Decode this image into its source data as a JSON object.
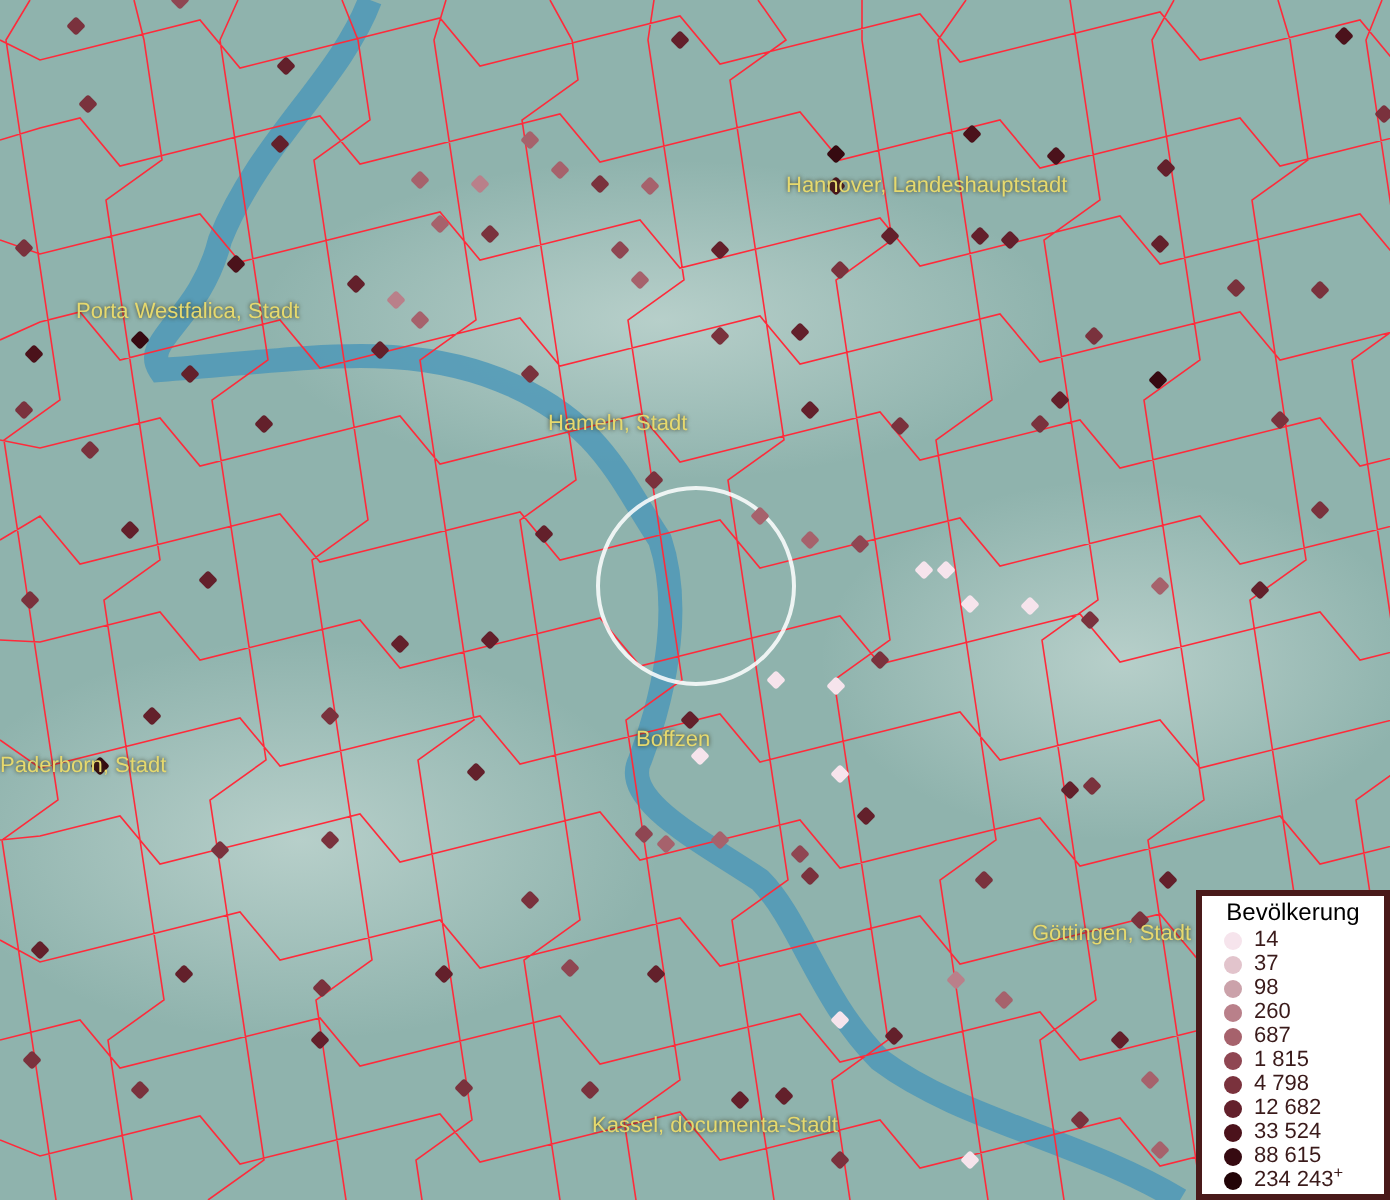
{
  "map": {
    "labels": [
      {
        "text": "Hannover, Landeshauptstadt"
      },
      {
        "text": "Porta Westfalica, Stadt"
      },
      {
        "text": "Hameln, Stadt"
      },
      {
        "text": "Boffzen"
      },
      {
        "text": "Paderborn, Stadt"
      },
      {
        "text": "Göttingen, Stadt"
      },
      {
        "text": "Kassel, documenta-Stadt"
      }
    ]
  },
  "legend": {
    "title": "Bevölkerung",
    "items": [
      {
        "label": "14",
        "color": "#f6e4ec"
      },
      {
        "label": "37",
        "color": "#e2c4cc"
      },
      {
        "label": "98",
        "color": "#cba2aa"
      },
      {
        "label": "260",
        "color": "#b9808a"
      },
      {
        "label": "687",
        "color": "#a6626c"
      },
      {
        "label": "1 815",
        "color": "#8f4652"
      },
      {
        "label": "4 798",
        "color": "#7a323d"
      },
      {
        "label": "12 682",
        "color": "#63202b"
      },
      {
        "label": "33 524",
        "color": "#4b121b"
      },
      {
        "label": "88 615",
        "color": "#360a11"
      },
      {
        "label": "234 243$^{+}$",
        "color": "#220407"
      }
    ]
  }
}
